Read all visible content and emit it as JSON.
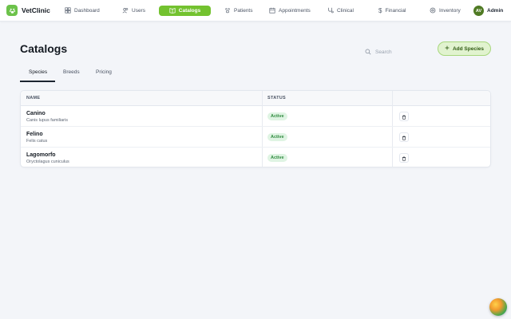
{
  "app": {
    "name": "VetClinic"
  },
  "nav": [
    {
      "label": "Dashboard",
      "icon": "grid-icon",
      "active": false
    },
    {
      "label": "Users",
      "icon": "users-icon",
      "active": false
    },
    {
      "label": "Catalogs",
      "icon": "book-icon",
      "active": true
    },
    {
      "label": "Patients",
      "icon": "paw-icon",
      "active": false
    },
    {
      "label": "Appointments",
      "icon": "calendar-icon",
      "active": false
    },
    {
      "label": "Clinical",
      "icon": "stethoscope-icon",
      "active": false
    },
    {
      "label": "Financial",
      "icon": "dollar-icon",
      "active": false
    },
    {
      "label": "Inventory",
      "icon": "box-icon",
      "active": false
    }
  ],
  "user": {
    "initials": "AV",
    "name": "Admin"
  },
  "page": {
    "title": "Catalogs",
    "search_placeholder": "Search",
    "add_button_label": "Add Species"
  },
  "tabs": [
    {
      "label": "Species",
      "active": true
    },
    {
      "label": "Breeds",
      "active": false
    },
    {
      "label": "Pricing",
      "active": false
    }
  ],
  "table": {
    "columns": [
      "NAME",
      "STATUS",
      ""
    ],
    "rows": [
      {
        "name": "Canino",
        "scientific": "Canis lupus familiaris",
        "status": "Active"
      },
      {
        "name": "Felino",
        "scientific": "Felis catus",
        "status": "Active"
      },
      {
        "name": "Lagomorfo",
        "scientific": "Oryctolagus cuniculus",
        "status": "Active"
      }
    ]
  },
  "colors": {
    "accent": "#73c22f",
    "accent_light": "#e1f3cf",
    "status_active_bg": "#dff4e3",
    "status_active_text": "#2f8a3e",
    "background": "#f3f5f9"
  }
}
